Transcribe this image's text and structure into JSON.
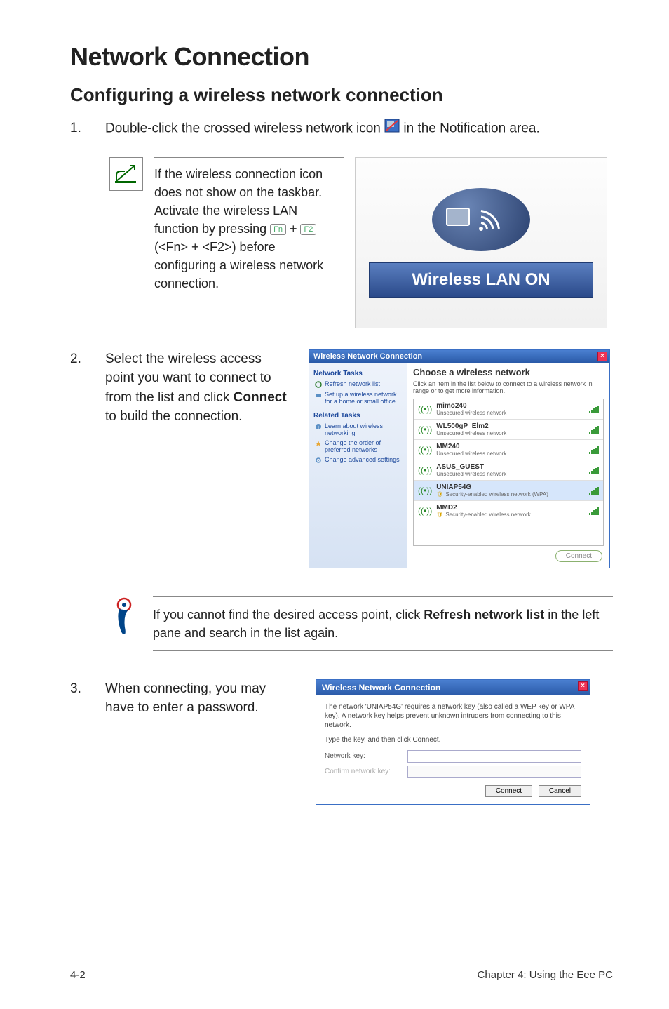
{
  "title": "Network Connection",
  "subtitle": "Configuring a wireless network connection",
  "step1": {
    "num": "1.",
    "text_before": "Double-click the crossed wireless network icon ",
    "text_after": " in the Notification area."
  },
  "note1": {
    "text_a": "If the wireless connection icon does not show on the taskbar. Activate the wireless LAN function by pressing ",
    "key1": "Fn",
    "plus": " + ",
    "key2": "F2",
    "text_b": " (<Fn> + <F2>) before configuring a wireless network connection."
  },
  "wlan_on": "Wireless LAN ON",
  "step2": {
    "num": "2.",
    "text_a": "Select the wireless access point you want to connect to from the list and click ",
    "bold": "Connect",
    "text_b": " to build the connection."
  },
  "wnc": {
    "title": "Wireless Network Connection",
    "left": {
      "tasks_h": "Network Tasks",
      "refresh": "Refresh network list",
      "setup": "Set up a wireless network for a home or small office",
      "related_h": "Related Tasks",
      "learn": "Learn about wireless networking",
      "order": "Change the order of preferred networks",
      "adv": "Change advanced settings"
    },
    "right": {
      "heading": "Choose a wireless network",
      "sub": "Click an item in the list below to connect to a wireless network in range or to get more information.",
      "connect": "Connect"
    },
    "networks": [
      {
        "name": "mimo240",
        "sec": "Unsecured wireless network",
        "shield": false
      },
      {
        "name": "WL500gP_Elm2",
        "sec": "Unsecured wireless network",
        "shield": false
      },
      {
        "name": "MM240",
        "sec": "Unsecured wireless network",
        "shield": false
      },
      {
        "name": "ASUS_GUEST",
        "sec": "Unsecured wireless network",
        "shield": false
      },
      {
        "name": "UNIAP54G",
        "sec": "Security-enabled wireless network (WPA)",
        "shield": true
      },
      {
        "name": "MMD2",
        "sec": "Security-enabled wireless network",
        "shield": true
      }
    ]
  },
  "tip": {
    "text_a": "If you cannot find the desired access point, click ",
    "bold": "Refresh network list",
    "text_b": " in the left pane and search in the list again."
  },
  "step3": {
    "num": "3.",
    "text": "When connecting, you may have to enter a password."
  },
  "pwd": {
    "title": "Wireless Network Connection",
    "msg": "The network 'UNIAP54G' requires a network key (also called a WEP key or WPA key). A network key helps prevent unknown intruders from connecting to this network.",
    "type_msg": "Type the key, and then click Connect.",
    "label1": "Network key:",
    "label2": "Confirm network key:",
    "connect": "Connect",
    "cancel": "Cancel"
  },
  "footer": {
    "left": "4-2",
    "right": "Chapter 4: Using the Eee PC"
  }
}
